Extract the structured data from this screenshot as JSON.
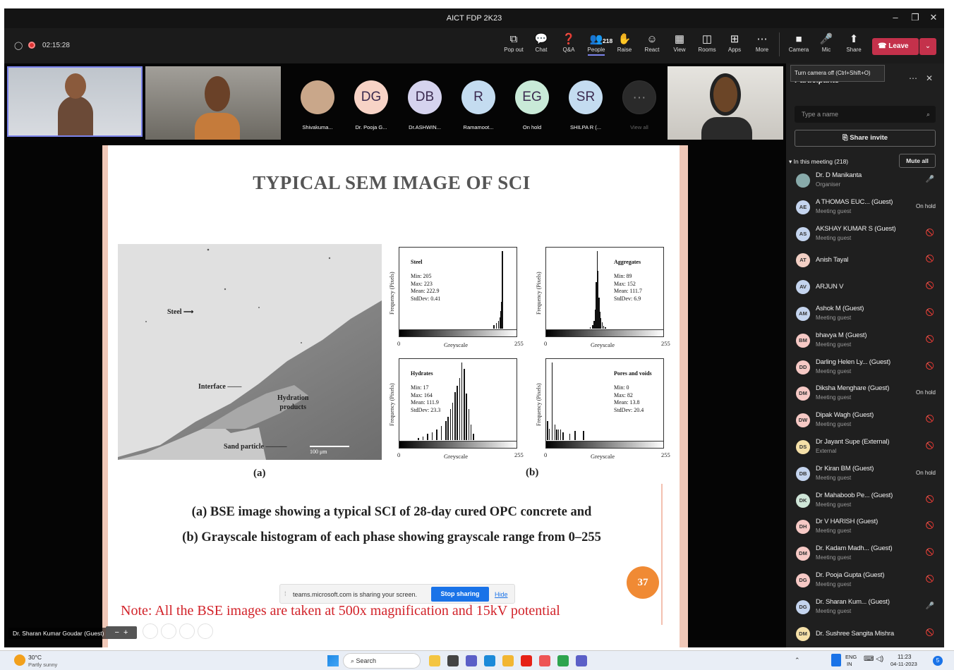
{
  "window": {
    "title": "AICT FDP 2K23",
    "minimize": "–",
    "maximize": "❐",
    "close": "✕"
  },
  "meeting": {
    "timer": "02:15:28",
    "people_count": "218"
  },
  "toolbar": {
    "items": [
      {
        "label": "Pop out",
        "icon": "popout-icon",
        "glyph": "⧉"
      },
      {
        "label": "Chat",
        "icon": "chat-icon",
        "glyph": "💬"
      },
      {
        "label": "Q&A",
        "icon": "qa-icon",
        "glyph": "❓"
      },
      {
        "label": "People",
        "icon": "people-icon",
        "glyph": "👥"
      },
      {
        "label": "Raise",
        "icon": "raise-hand-icon",
        "glyph": "✋"
      },
      {
        "label": "React",
        "icon": "react-icon",
        "glyph": "☺"
      },
      {
        "label": "View",
        "icon": "view-icon",
        "glyph": "▦"
      },
      {
        "label": "Rooms",
        "icon": "rooms-icon",
        "glyph": "◫"
      },
      {
        "label": "Apps",
        "icon": "apps-icon",
        "glyph": "⊞"
      },
      {
        "label": "More",
        "icon": "more-icon",
        "glyph": "⋯"
      }
    ],
    "camera": "Camera",
    "mic": "Mic",
    "share": "Share",
    "leave": "Leave",
    "tooltip": "Turn camera off (Ctrl+Shift+O)"
  },
  "participants_strip": [
    {
      "name": "Shivakuma...",
      "initials": "",
      "color": "#c9a78a"
    },
    {
      "name": "Dr. Pooja G...",
      "initials": "DG",
      "color": "#f7d3c6"
    },
    {
      "name": "Dr.ASHWIN...",
      "initials": "DB",
      "color": "#d5d3ee"
    },
    {
      "name": "Ramamoot...",
      "initials": "R",
      "color": "#c4dcf0"
    },
    {
      "name": "On hold",
      "initials": "EG",
      "color": "#c9ead8"
    },
    {
      "name": "SHILPA R (...",
      "initials": "SR",
      "color": "#c4dcf0"
    },
    {
      "name": "View all",
      "initials": "···",
      "color": "#2a2a2a"
    }
  ],
  "slide": {
    "title": "TYPICAL SEM IMAGE OF SCI",
    "sem_labels": {
      "steel": "Steel",
      "interface": "Interface",
      "hydration": "Hydration\nproducts",
      "sand": "Sand particle",
      "scale": "100 μm"
    },
    "panel_a": "(a)",
    "panel_b": "(b)",
    "caption1": "(a) BSE image showing a typical SCI of 28-day cured OPC concrete and",
    "caption2": "(b) Grayscale histogram of each phase showing grayscale range from 0–255",
    "page": "37",
    "note": "Note: All the BSE images are taken at 500x magnification and 15kV potential",
    "ylabel": "Frequency (Pixels)",
    "xlabel": "Greyscale",
    "x0": "0",
    "x1": "255"
  },
  "chart_data": [
    {
      "type": "bar",
      "title": "Steel",
      "stats": "Min: 205\nMax: 223\nMean: 222.9\nStdDev: 0.41",
      "xlabel": "Greyscale",
      "ylabel": "Frequency (Pixels)",
      "xlim": [
        0,
        255
      ],
      "x": [
        205,
        210,
        215,
        218,
        220,
        221,
        222,
        223
      ],
      "values": [
        2,
        3,
        4,
        6,
        9,
        14,
        25,
        40
      ]
    },
    {
      "type": "bar",
      "title": "Aggregates",
      "stats": "Min: 89\nMax: 152\nMean: 111.7\nStdDev: 6.9",
      "xlabel": "Greyscale",
      "ylabel": "Frequency (Pixels)",
      "xlim": [
        0,
        255
      ],
      "x": [
        95,
        100,
        103,
        106,
        108,
        110,
        112,
        114,
        116,
        118,
        121,
        124,
        128
      ],
      "values": [
        2,
        5,
        10,
        25,
        60,
        100,
        75,
        40,
        22,
        14,
        8,
        4,
        2
      ]
    },
    {
      "type": "bar",
      "title": "Hydrates",
      "stats": "Min: 17\nMax: 164\nMean: 111.9\nStdDev: 23.3",
      "xlabel": "Greyscale",
      "ylabel": "Frequency (Pixels)",
      "xlim": [
        0,
        255
      ],
      "x": [
        40,
        50,
        60,
        70,
        80,
        90,
        100,
        105,
        110,
        115,
        120,
        125,
        130,
        135,
        140,
        145,
        150,
        155,
        160
      ],
      "values": [
        3,
        5,
        8,
        10,
        14,
        18,
        25,
        30,
        40,
        48,
        62,
        70,
        80,
        100,
        92,
        60,
        40,
        20,
        8
      ]
    },
    {
      "type": "bar",
      "title": "Pores and voids",
      "stats": "Min: 0\nMax: 82\nMean: 13.8\nStdDev: 20.4",
      "xlabel": "Greyscale",
      "ylabel": "Frequency (Pixels)",
      "xlim": [
        0,
        255
      ],
      "x": [
        2,
        6,
        12,
        18,
        22,
        26,
        30,
        36,
        50,
        62,
        80
      ],
      "values": [
        25,
        15,
        100,
        20,
        14,
        14,
        14,
        10,
        8,
        12,
        12
      ]
    }
  ],
  "share_bar": {
    "text": "teams.microsoft.com is sharing your screen.",
    "stop": "Stop sharing",
    "hide": "Hide"
  },
  "presenter_label": "Dr. Sharan Kumar Goudar (Guest)",
  "sidebar": {
    "title": "Participants",
    "search_placeholder": "Type a name",
    "share_invite": "Share invite",
    "section": "In this meeting (218)",
    "mute_all": "Mute all",
    "people": [
      {
        "initials": "",
        "name": "Dr. D Manikanta",
        "role": "Organiser",
        "status": "",
        "color": "#8aa"
      },
      {
        "initials": "AE",
        "name": "A THOMAS EUC...  (Guest)",
        "role": "Meeting guest",
        "status": "On hold",
        "color": "#c4d4ee"
      },
      {
        "initials": "AS",
        "name": "AKSHAY KUMAR S (Guest)",
        "role": "Meeting guest",
        "status": "",
        "color": "#c4d4ee"
      },
      {
        "initials": "AT",
        "name": "Anish Tayal",
        "role": "",
        "status": "",
        "color": "#f2cfc4"
      },
      {
        "initials": "AV",
        "name": "ARJUN V",
        "role": "",
        "status": "",
        "color": "#c4d4ee"
      },
      {
        "initials": "AM",
        "name": "Ashok M (Guest)",
        "role": "Meeting guest",
        "status": "",
        "color": "#c4d4ee"
      },
      {
        "initials": "BM",
        "name": "bhavya M (Guest)",
        "role": "Meeting guest",
        "status": "",
        "color": "#f6c9c5"
      },
      {
        "initials": "DD",
        "name": "Darling Helen Ly...  (Guest)",
        "role": "Meeting guest",
        "status": "",
        "color": "#f6c9c5"
      },
      {
        "initials": "DM",
        "name": "Diksha Menghare (Guest)",
        "role": "Meeting guest",
        "status": "On hold",
        "color": "#f6c9c5"
      },
      {
        "initials": "DW",
        "name": "Dipak Wagh (Guest)",
        "role": "Meeting guest",
        "status": "",
        "color": "#f6c9c5"
      },
      {
        "initials": "DS",
        "name": "Dr Jayant Supe (External)",
        "role": "External",
        "status": "",
        "color": "#f5e0a8"
      },
      {
        "initials": "DB",
        "name": "Dr Kiran BM (Guest)",
        "role": "Meeting guest",
        "status": "On hold",
        "color": "#c4d4ee"
      },
      {
        "initials": "DK",
        "name": "Dr Mahaboob Pe...  (Guest)",
        "role": "Meeting guest",
        "status": "",
        "color": "#cfe6d8"
      },
      {
        "initials": "DH",
        "name": "Dr V HARISH (Guest)",
        "role": "Meeting guest",
        "status": "",
        "color": "#f6c9c5"
      },
      {
        "initials": "DM",
        "name": "Dr. Kadam Madh...  (Guest)",
        "role": "Meeting guest",
        "status": "",
        "color": "#f6c9c5"
      },
      {
        "initials": "DG",
        "name": "Dr. Pooja Gupta (Guest)",
        "role": "Meeting guest",
        "status": "",
        "color": "#f6c9c5"
      },
      {
        "initials": "DG",
        "name": "Dr. Sharan Kum...  (Guest)",
        "role": "Meeting guest",
        "status": "",
        "color": "#c4d4ee"
      },
      {
        "initials": "DM",
        "name": "Dr. Sushree Sangita Mishra",
        "role": "",
        "status": "",
        "color": "#f5e0a8"
      }
    ]
  },
  "taskbar": {
    "temp": "30°C",
    "weather": "Partly sunny",
    "search": "Search",
    "lang1": "ENG",
    "lang2": "IN",
    "time": "11:23",
    "date": "04-11-2023",
    "notif": "5"
  }
}
